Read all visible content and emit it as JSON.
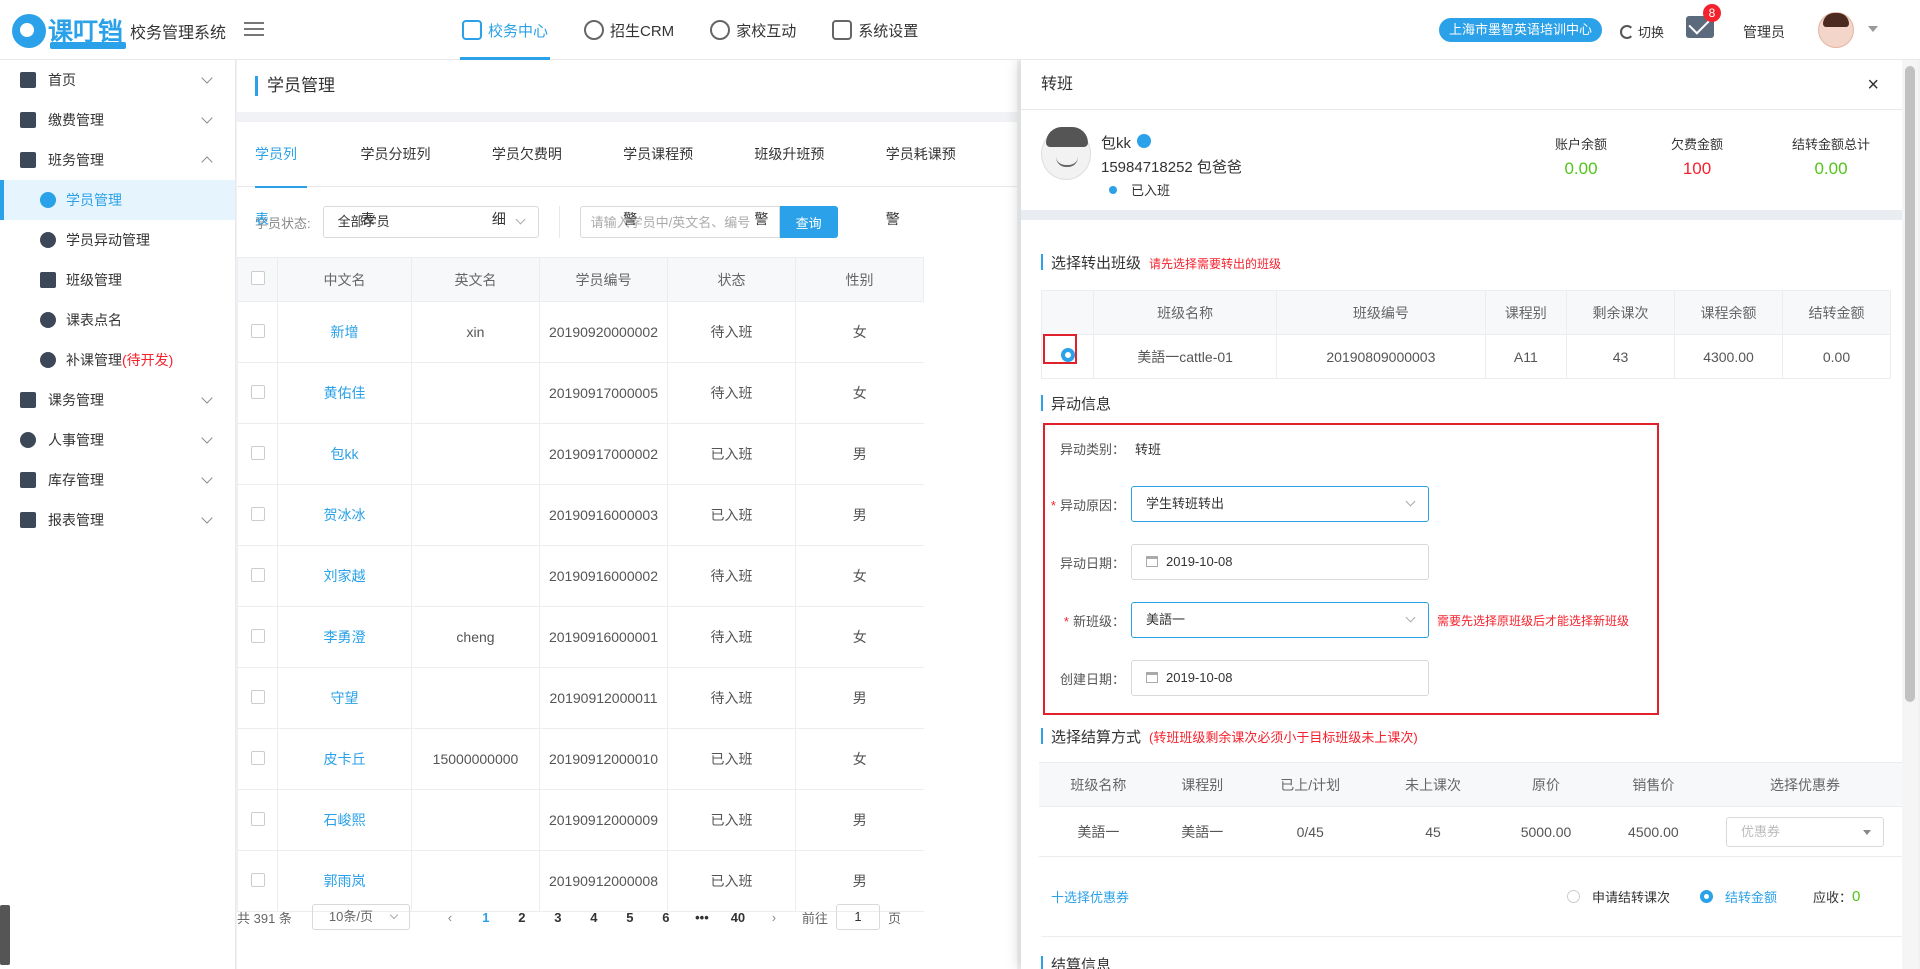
{
  "header": {
    "logo_text": "课叮铛",
    "system_name": "校务管理系统",
    "nav": [
      {
        "label": "校务中心",
        "icon": "cube-icon",
        "active": true
      },
      {
        "label": "招生CRM",
        "icon": "chart-icon",
        "active": false
      },
      {
        "label": "家校互动",
        "icon": "leaf-icon",
        "active": false
      },
      {
        "label": "系统设置",
        "icon": "layers-icon",
        "active": false
      }
    ],
    "school": "上海市墨智英语培训中心",
    "switch_label": "切换",
    "mail_badge": "8",
    "user": "管理员"
  },
  "sidebar": {
    "items": [
      {
        "label": "首页",
        "icon": "home-icon"
      },
      {
        "label": "缴费管理",
        "icon": "wallet-icon"
      },
      {
        "label": "班务管理",
        "icon": "class-icon",
        "expanded": true
      },
      {
        "label": "学员管理",
        "icon": "student-icon",
        "active": true
      },
      {
        "label": "学员异动管理",
        "icon": "student-change-icon"
      },
      {
        "label": "班级管理",
        "icon": "grid-icon"
      },
      {
        "label": "课表点名",
        "icon": "rollcall-icon"
      },
      {
        "label": "补课管理",
        "icon": "makeup-icon",
        "note": "(待开发)"
      },
      {
        "label": "课务管理",
        "icon": "book-icon"
      },
      {
        "label": "人事管理",
        "icon": "people-icon"
      },
      {
        "label": "库存管理",
        "icon": "stock-icon"
      },
      {
        "label": "报表管理",
        "icon": "report-icon"
      }
    ]
  },
  "page": {
    "title": "学员管理",
    "tabs": [
      "学员列表",
      "学员分班列表",
      "学员欠费明细",
      "学员课程预警",
      "班级升班预警",
      "学员耗课预警"
    ],
    "filter": {
      "status_label": "学员状态:",
      "status_value": "全部学员",
      "search_placeholder": "请输入学员中/英文名、编号",
      "query_button": "查询"
    },
    "table": {
      "headers": [
        "中文名",
        "英文名",
        "学员编号",
        "状态",
        "性别"
      ],
      "rows": [
        {
          "cn": "新增",
          "en": "xin",
          "id": "20190920000002",
          "status": "待入班",
          "gender": "女"
        },
        {
          "cn": "黄佑佳",
          "en": "",
          "id": "20190917000005",
          "status": "待入班",
          "gender": "女"
        },
        {
          "cn": "包kk",
          "en": "",
          "id": "20190917000002",
          "status": "已入班",
          "gender": "男"
        },
        {
          "cn": "贺冰冰",
          "en": "",
          "id": "20190916000003",
          "status": "已入班",
          "gender": "男"
        },
        {
          "cn": "刘家越",
          "en": "",
          "id": "20190916000002",
          "status": "待入班",
          "gender": "女"
        },
        {
          "cn": "李勇澄",
          "en": "cheng",
          "id": "20190916000001",
          "status": "待入班",
          "gender": "女"
        },
        {
          "cn": "守望",
          "en": "",
          "id": "20190912000011",
          "status": "待入班",
          "gender": "男"
        },
        {
          "cn": "皮卡丘",
          "en": "15000000000",
          "id": "20190912000010",
          "status": "已入班",
          "gender": "女"
        },
        {
          "cn": "石峻熙",
          "en": "",
          "id": "20190912000009",
          "status": "已入班",
          "gender": "男"
        },
        {
          "cn": "郭雨岚",
          "en": "",
          "id": "20190912000008",
          "status": "已入班",
          "gender": "男"
        }
      ]
    },
    "pager": {
      "total": "共 391 条",
      "page_size": "10条/页",
      "pages": [
        "1",
        "2",
        "3",
        "4",
        "5",
        "6",
        "•••",
        "40"
      ],
      "prev": "‹",
      "next": "›",
      "goto_label": "前往",
      "goto_value": "1",
      "page_unit": "页"
    }
  },
  "drawer": {
    "title": "转班",
    "close": "×",
    "student": {
      "name": "包kk",
      "phone": "15984718252 包爸爸",
      "status": "已入班"
    },
    "amounts": [
      {
        "label": "账户余额",
        "value": "0.00",
        "color": "#52c41a"
      },
      {
        "label": "欠费金额",
        "value": "100",
        "color": "#f5222d"
      },
      {
        "label": "结转金额总计",
        "value": "0.00",
        "color": "#52c41a"
      }
    ],
    "out_class": {
      "title": "选择转出班级",
      "hint": "请先选择需要转出的班级",
      "headers": [
        "班级名称",
        "班级编号",
        "课程别",
        "剩余课次",
        "课程余额",
        "结转金额"
      ],
      "row": {
        "name": "美語一cattle-01",
        "code": "20190809000003",
        "course": "A11",
        "remain": "43",
        "balance": "4300.00",
        "carry": "0.00"
      }
    },
    "change": {
      "title": "异动信息",
      "type_label": "异动类别：",
      "type_value": "转班",
      "reason_label": "异动原因：",
      "reason_value": "学生转班转出",
      "date_label": "异动日期：",
      "date_value": "2019-10-08",
      "newclass_label": "新班级：",
      "newclass_value": "美語一",
      "newclass_hint": "需要先选择原班级后才能选择新班级",
      "create_label": "创建日期：",
      "create_value": "2019-10-08"
    },
    "settle": {
      "title": "选择结算方式",
      "hint": "(转班班级剩余课次必须小于目标班级未上课次)",
      "headers": [
        "班级名称",
        "课程别",
        "已上/计划",
        "未上课次",
        "原价",
        "销售价",
        "选择优惠券"
      ],
      "row": {
        "name": "美語一",
        "course": "美語一",
        "progress": "0/45",
        "remain": "45",
        "price": "5000.00",
        "sale": "4500.00",
        "coupon_placeholder": "优惠券"
      },
      "add_coupon": "十选择优惠券",
      "opt1": "申请结转课次",
      "opt2": "结转金额",
      "due_label": "应收：",
      "due_value": "0"
    },
    "next_section": "结算信息"
  }
}
